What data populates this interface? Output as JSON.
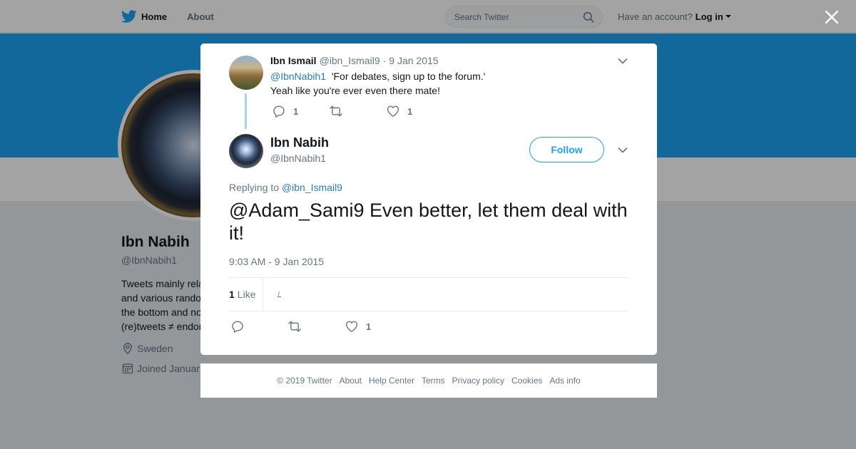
{
  "topbar": {
    "home_label": "Home",
    "about_label": "About",
    "search_placeholder": "Search Twitter",
    "account_prompt": "Have an account?",
    "login_label": "Log in"
  },
  "background_profile": {
    "name": "Ibn Nabih",
    "handle": "@IbnNabih1",
    "bio": "Tweets mainly rela\nand various rando\nthe bottom and no\n(re)tweets ≠ endor",
    "location": "Sweden",
    "joined": "Joined Januar"
  },
  "parent_tweet": {
    "author_name": "Ibn Ismail",
    "author_handle": "@ibn_Ismail9",
    "separator": "·",
    "date": "9 Jan 2015",
    "mention": "@IbnNabih1",
    "line1": "'For debates, sign up to the forum.'",
    "line2": "Yeah like you're ever even there mate!",
    "reply_count": "1",
    "like_count": "1"
  },
  "main_tweet": {
    "author_name": "Ibn Nabih",
    "author_handle": "@IbnNabih1",
    "follow_label": "Follow",
    "replying_prefix": "Replying to",
    "replying_to": "@ibn_Ismail9",
    "text": "@Adam_Sami9 Even better, let them deal with it!",
    "timestamp": "9:03 AM - 9 Jan 2015",
    "likes_count": "1",
    "likes_label": "Like",
    "footer_like_count": "1"
  },
  "footer": {
    "copyright": "© 2019 Twitter",
    "links": [
      "About",
      "Help Center",
      "Terms",
      "Privacy policy",
      "Cookies",
      "Ads info"
    ]
  },
  "colors": {
    "brand_blue": "#1da1f2",
    "link_blue": "#2b7bb9",
    "secondary_text": "#657786"
  }
}
